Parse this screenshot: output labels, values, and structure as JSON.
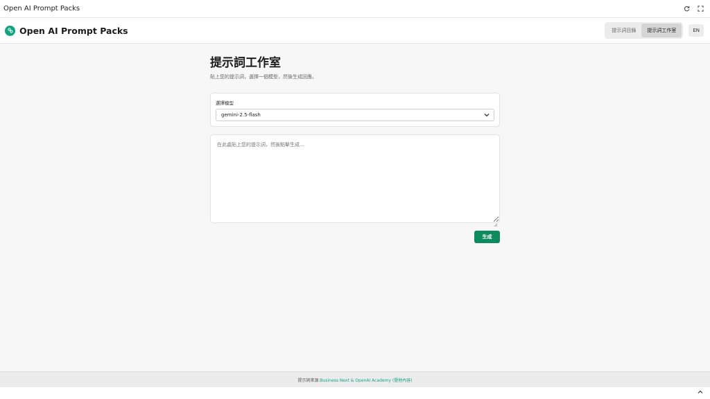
{
  "window": {
    "title": "Open AI Prompt Packs"
  },
  "header": {
    "brand": "Open AI Prompt Packs",
    "tabs": [
      {
        "label": "提示詞目錄",
        "active": false
      },
      {
        "label": "提示詞工作室",
        "active": true
      }
    ],
    "lang": "EN"
  },
  "main": {
    "title": "提示詞工作室",
    "subtitle": "貼上您的提示詞，選擇一個模型，然後生成回應。",
    "model": {
      "label": "選擇模型",
      "selected": "gemini-2.5-flash"
    },
    "prompt": {
      "placeholder": "在此處貼上您的提示詞，然後點擊生成..."
    },
    "generate_label": "生成"
  },
  "footer": {
    "prefix": "提示詞來源: ",
    "link": "Business Next & OpenAI Academy (暨他內容)"
  },
  "colors": {
    "accent": "#10a37f",
    "button": "#0e8a5f"
  },
  "icons": [
    "refresh-icon",
    "fullscreen-icon",
    "logo-icon",
    "chevron-down-icon",
    "resize-handle-icon",
    "chevron-up-icon"
  ]
}
